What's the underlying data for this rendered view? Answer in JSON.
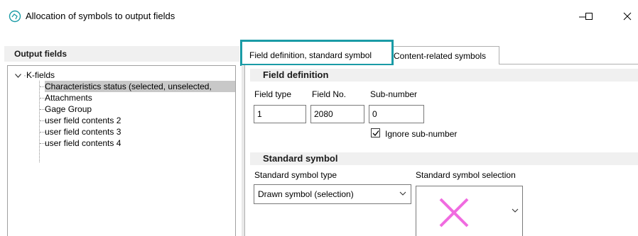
{
  "window": {
    "title": "Allocation of symbols to output fields",
    "controls": {
      "minimize": "minimize-icon",
      "maximize": "maximize-icon",
      "close": "close-icon"
    }
  },
  "left_pane": {
    "header": "Output fields",
    "tree": {
      "root_label": "K-fields",
      "items": [
        {
          "label": "Characteristics status (selected, unselected,",
          "selected": true
        },
        {
          "label": "Attachments",
          "selected": false
        },
        {
          "label": "Gage Group",
          "selected": false
        },
        {
          "label": "user field contents 2",
          "selected": false
        },
        {
          "label": "user field contents 3",
          "selected": false
        },
        {
          "label": "user field contents 4",
          "selected": false
        }
      ]
    }
  },
  "tabs": [
    {
      "label": "Field definition, standard symbol",
      "active": true
    },
    {
      "label": "Content-related symbols",
      "active": false
    }
  ],
  "field_definition": {
    "header": "Field definition",
    "field_type_label": "Field type",
    "field_type_value": "1",
    "field_no_label": "Field No.",
    "field_no_value": "2080",
    "sub_number_label": "Sub-number",
    "sub_number_value": "0",
    "ignore_sub_number_label": "Ignore sub-number",
    "ignore_sub_number_checked": true
  },
  "standard_symbol": {
    "header": "Standard symbol",
    "type_label": "Standard symbol type",
    "type_value": "Drawn symbol (selection)",
    "selection_label": "Standard symbol selection",
    "selection_icon": "magenta-x-symbol",
    "symbol_color": "#f06be0"
  },
  "colors": {
    "highlight_outline": "#1a9ba6",
    "section_header_bg": "#f0f0f0",
    "tree_selected_bg": "#c8c8c8"
  }
}
